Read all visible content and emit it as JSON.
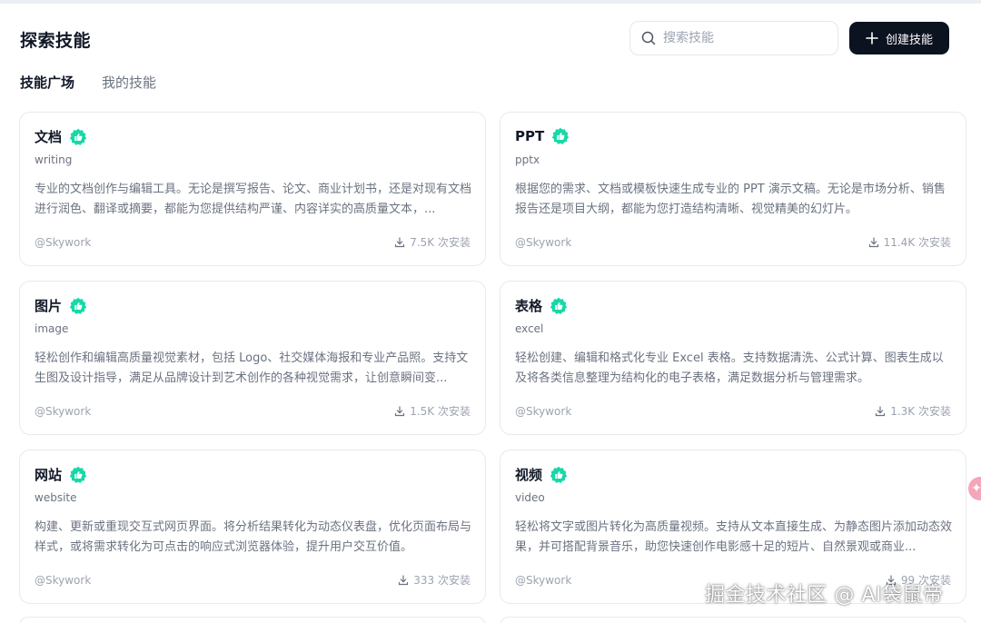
{
  "colors": {
    "accent_badge": "#16d9a7",
    "button_bg": "#0b1220"
  },
  "header": {
    "title": "探索技能",
    "search_placeholder": "搜索技能",
    "search_icon": "search-icon",
    "create_button_label": "创建技能",
    "create_icon": "plus-icon"
  },
  "tabs": [
    {
      "label": "技能广场",
      "active": true
    },
    {
      "label": "我的技能",
      "active": false
    }
  ],
  "skills": [
    {
      "title": "文档",
      "slug": "writing",
      "description": "专业的文档创作与编辑工具。无论是撰写报告、论文、商业计划书，还是对现有文档进行润色、翻译或摘要，都能为您提供结构严谨、内容详实的高质量文本，...",
      "author": "@Skywork",
      "installs": "7.5K 次安装"
    },
    {
      "title": "PPT",
      "slug": "pptx",
      "description": "根据您的需求、文档或模板快速生成专业的 PPT 演示文稿。无论是市场分析、销售报告还是项目大纲，都能为您打造结构清晰、视觉精美的幻灯片。",
      "author": "@Skywork",
      "installs": "11.4K 次安装"
    },
    {
      "title": "图片",
      "slug": "image",
      "description": "轻松创作和编辑高质量视觉素材，包括 Logo、社交媒体海报和专业产品照。支持文生图及设计指导，满足从品牌设计到艺术创作的各种视觉需求，让创意瞬间变...",
      "author": "@Skywork",
      "installs": "1.5K 次安装"
    },
    {
      "title": "表格",
      "slug": "excel",
      "description": "轻松创建、编辑和格式化专业 Excel 表格。支持数据清洗、公式计算、图表生成以及将各类信息整理为结构化的电子表格，满足数据分析与管理需求。",
      "author": "@Skywork",
      "installs": "1.3K 次安装"
    },
    {
      "title": "网站",
      "slug": "website",
      "description": "构建、更新或重现交互式网页界面。将分析结果转化为动态仪表盘，优化页面布局与样式，或将需求转化为可点击的响应式浏览器体验，提升用户交互价值。",
      "author": "@Skywork",
      "installs": "333 次安装"
    },
    {
      "title": "视频",
      "slug": "video",
      "description": "轻松将文字或图片转化为高质量视频。支持从文本直接生成、为静态图片添加动态效果，并可搭配背景音乐，助您快速创作电影感十足的短片、自然景观或商业...",
      "author": "@Skywork",
      "installs": "99 次安装"
    }
  ],
  "watermark": "掘金技术社区 @ AI袋鼠帝"
}
